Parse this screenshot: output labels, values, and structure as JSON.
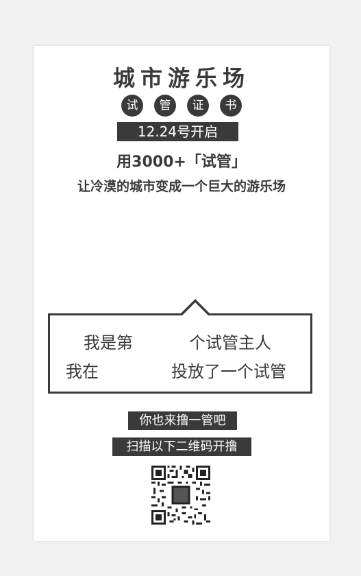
{
  "title": "城市游乐场",
  "subtitle_chars": [
    "试",
    "管",
    "证",
    "书"
  ],
  "date_badge": "12.24号开启",
  "headline": "用3000+「试管」",
  "tagline": "让冷漠的城市变成一个巨大的游乐场",
  "bubble": {
    "row1_left": "我是第",
    "row1_right": "个试管主人",
    "row2_left": "我在",
    "row2_right": "投放了一个试管"
  },
  "cta_primary": "你也来撸一管吧",
  "cta_secondary": "扫描以下二维码开撸",
  "colors": {
    "ink": "#3a3a3a",
    "background": "#f2f2f2",
    "card": "#ffffff"
  }
}
